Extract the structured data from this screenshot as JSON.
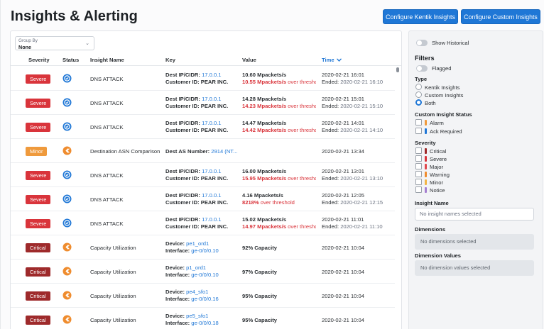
{
  "header": {
    "title": "Insights & Alerting",
    "configure_kentik_label": "Configure Kentik Insights",
    "configure_custom_label": "Configure Custom Insights"
  },
  "colors": {
    "accent": "#1f77d6",
    "severe": "#d9343b",
    "minor": "#ef9a3c",
    "critical": "#9e2a2b",
    "status_blue": "#1f77d6",
    "status_orange": "#ef8c2e"
  },
  "group_by": {
    "label": "Group By",
    "value": "None"
  },
  "columns": {
    "severity": "Severity",
    "status": "Status",
    "insight_name": "Insight Name",
    "key": "Key",
    "value": "Value",
    "time": "Time"
  },
  "rows": [
    {
      "severity": "Severe",
      "status_icon": "check-circle-icon",
      "name": "DNS ATTACK",
      "key1_label": "Dest IP/CIDR: ",
      "key1_link": "17.0.0.1",
      "key2_label": "Customer ID: PEAR INC.",
      "key2_link": "",
      "value1": "10.60 Mpackets/s",
      "value2_bold": "10.55 Mpackets/s",
      "value2_rest": " over threshold",
      "time1": "2020-02-21 16:01",
      "time2_label": "Ended: ",
      "time2_value": "2020-02-21 16:10"
    },
    {
      "severity": "Severe",
      "status_icon": "check-circle-icon",
      "name": "DNS ATTACK",
      "key1_label": "Dest IP/CIDR: ",
      "key1_link": "17.0.0.1",
      "key2_label": "Customer ID: PEAR INC.",
      "key2_link": "",
      "value1": "14.28 Mpackets/s",
      "value2_bold": "14.23 Mpackets/s",
      "value2_rest": " over threshold",
      "time1": "2020-02-21 15:01",
      "time2_label": "Ended: ",
      "time2_value": "2020-02-21 15:10"
    },
    {
      "severity": "Severe",
      "status_icon": "check-circle-icon",
      "name": "DNS ATTACK",
      "key1_label": "Dest IP/CIDR: ",
      "key1_link": "17.0.0.1",
      "key2_label": "Customer ID: PEAR INC.",
      "key2_link": "",
      "value1": "14.47 Mpackets/s",
      "value2_bold": "14.42 Mpackets/s",
      "value2_rest": " over threshold",
      "time1": "2020-02-21 14:01",
      "time2_label": "Ended: ",
      "time2_value": "2020-02-21 14:10"
    },
    {
      "severity": "Minor",
      "status_icon": "kentik-icon",
      "name": "Destination ASN Comparison",
      "key1_label": "Dest AS Number: ",
      "key1_link": "2914",
      "key1_suffix": " (NT...",
      "single": true,
      "time1": "2020-02-21 13:34"
    },
    {
      "severity": "Severe",
      "status_icon": "check-circle-icon",
      "name": "DNS ATTACK",
      "key1_label": "Dest IP/CIDR: ",
      "key1_link": "17.0.0.1",
      "key2_label": "Customer ID: PEAR INC.",
      "key2_link": "",
      "value1": "16.00 Mpackets/s",
      "value2_bold": "15.95 Mpackets/s",
      "value2_rest": " over threshold",
      "time1": "2020-02-21 13:01",
      "time2_label": "Ended: ",
      "time2_value": "2020-02-21 13:10"
    },
    {
      "severity": "Severe",
      "status_icon": "check-circle-icon",
      "name": "DNS ATTACK",
      "key1_label": "Dest IP/CIDR: ",
      "key1_link": "17.0.0.1",
      "key2_label": "Customer ID: PEAR INC.",
      "key2_link": "",
      "value1": "4.16 Mpackets/s",
      "value2_bold": "8218%",
      "value2_rest": " over threshold",
      "time1": "2020-02-21 12:05",
      "time2_label": "Ended: ",
      "time2_value": "2020-02-21 12:15"
    },
    {
      "severity": "Severe",
      "status_icon": "check-circle-icon",
      "name": "DNS ATTACK",
      "key1_label": "Dest IP/CIDR: ",
      "key1_link": "17.0.0.1",
      "key2_label": "Customer ID: PEAR INC.",
      "key2_link": "",
      "value1": "15.02 Mpackets/s",
      "value2_bold": "14.97 Mpackets/s",
      "value2_rest": " over threshold",
      "time1": "2020-02-21 11:01",
      "time2_label": "Ended: ",
      "time2_value": "2020-02-21 11:10"
    },
    {
      "severity": "Critical",
      "status_icon": "kentik-icon",
      "name": "Capacity Utilization",
      "key1_label": "Device: ",
      "key1_link": "pe1_ord1",
      "key2_label": "Interface: ",
      "key2_link": "ge-0/0/0.10",
      "value_single": "92% Capacity",
      "time_single": "2020-02-21 10:04"
    },
    {
      "severity": "Critical",
      "status_icon": "kentik-icon",
      "name": "Capacity Utilization",
      "key1_label": "Device: ",
      "key1_link": "p1_ord1",
      "key2_label": "Interface: ",
      "key2_link": "ge-0/0/0.10",
      "value_single": "97% Capacity",
      "time_single": "2020-02-21 10:04"
    },
    {
      "severity": "Critical",
      "status_icon": "kentik-icon",
      "name": "Capacity Utilization",
      "key1_label": "Device: ",
      "key1_link": "pe4_sfo1",
      "key2_label": "Interface: ",
      "key2_link": "ge-0/0/0.16",
      "value_single": "95% Capacity",
      "time_single": "2020-02-21 10:04"
    },
    {
      "severity": "Critical",
      "status_icon": "kentik-icon",
      "name": "Capacity Utilization",
      "key1_label": "Device: ",
      "key1_link": "pe5_sfo1",
      "key2_label": "Interface: ",
      "key2_link": "ge-0/0/0.18",
      "value_single": "95% Capacity",
      "time_single": "2020-02-21 10:04"
    }
  ],
  "sidebar": {
    "show_historical": "Show Historical",
    "filters_title": "Filters",
    "flagged": "Flagged",
    "type_title": "Type",
    "type_options": [
      "Kentik Insights",
      "Custom Insights",
      "Both"
    ],
    "type_selected": "Both",
    "custom_status_title": "Custom Insight Status",
    "custom_status_options": [
      {
        "label": "Alarm",
        "color": "#ef9a3c"
      },
      {
        "label": "Ack Required",
        "color": "#1f77d6"
      }
    ],
    "severity_title": "Severity",
    "severity_options": [
      {
        "label": "Critical",
        "color": "#9e2a2b"
      },
      {
        "label": "Severe",
        "color": "#d9343b"
      },
      {
        "label": "Major",
        "color": "#e0474c"
      },
      {
        "label": "Warning",
        "color": "#ef8c2e"
      },
      {
        "label": "Minor",
        "color": "#f2b544"
      },
      {
        "label": "Notice",
        "color": "#a57fd0"
      }
    ],
    "insight_name_title": "Insight Name",
    "insight_name_placeholder": "No insight names selected",
    "dimensions_title": "Dimensions",
    "dimensions_placeholder": "No dimensions selected",
    "dimension_values_title": "Dimension Values",
    "dimension_values_placeholder": "No dimension values selected"
  }
}
